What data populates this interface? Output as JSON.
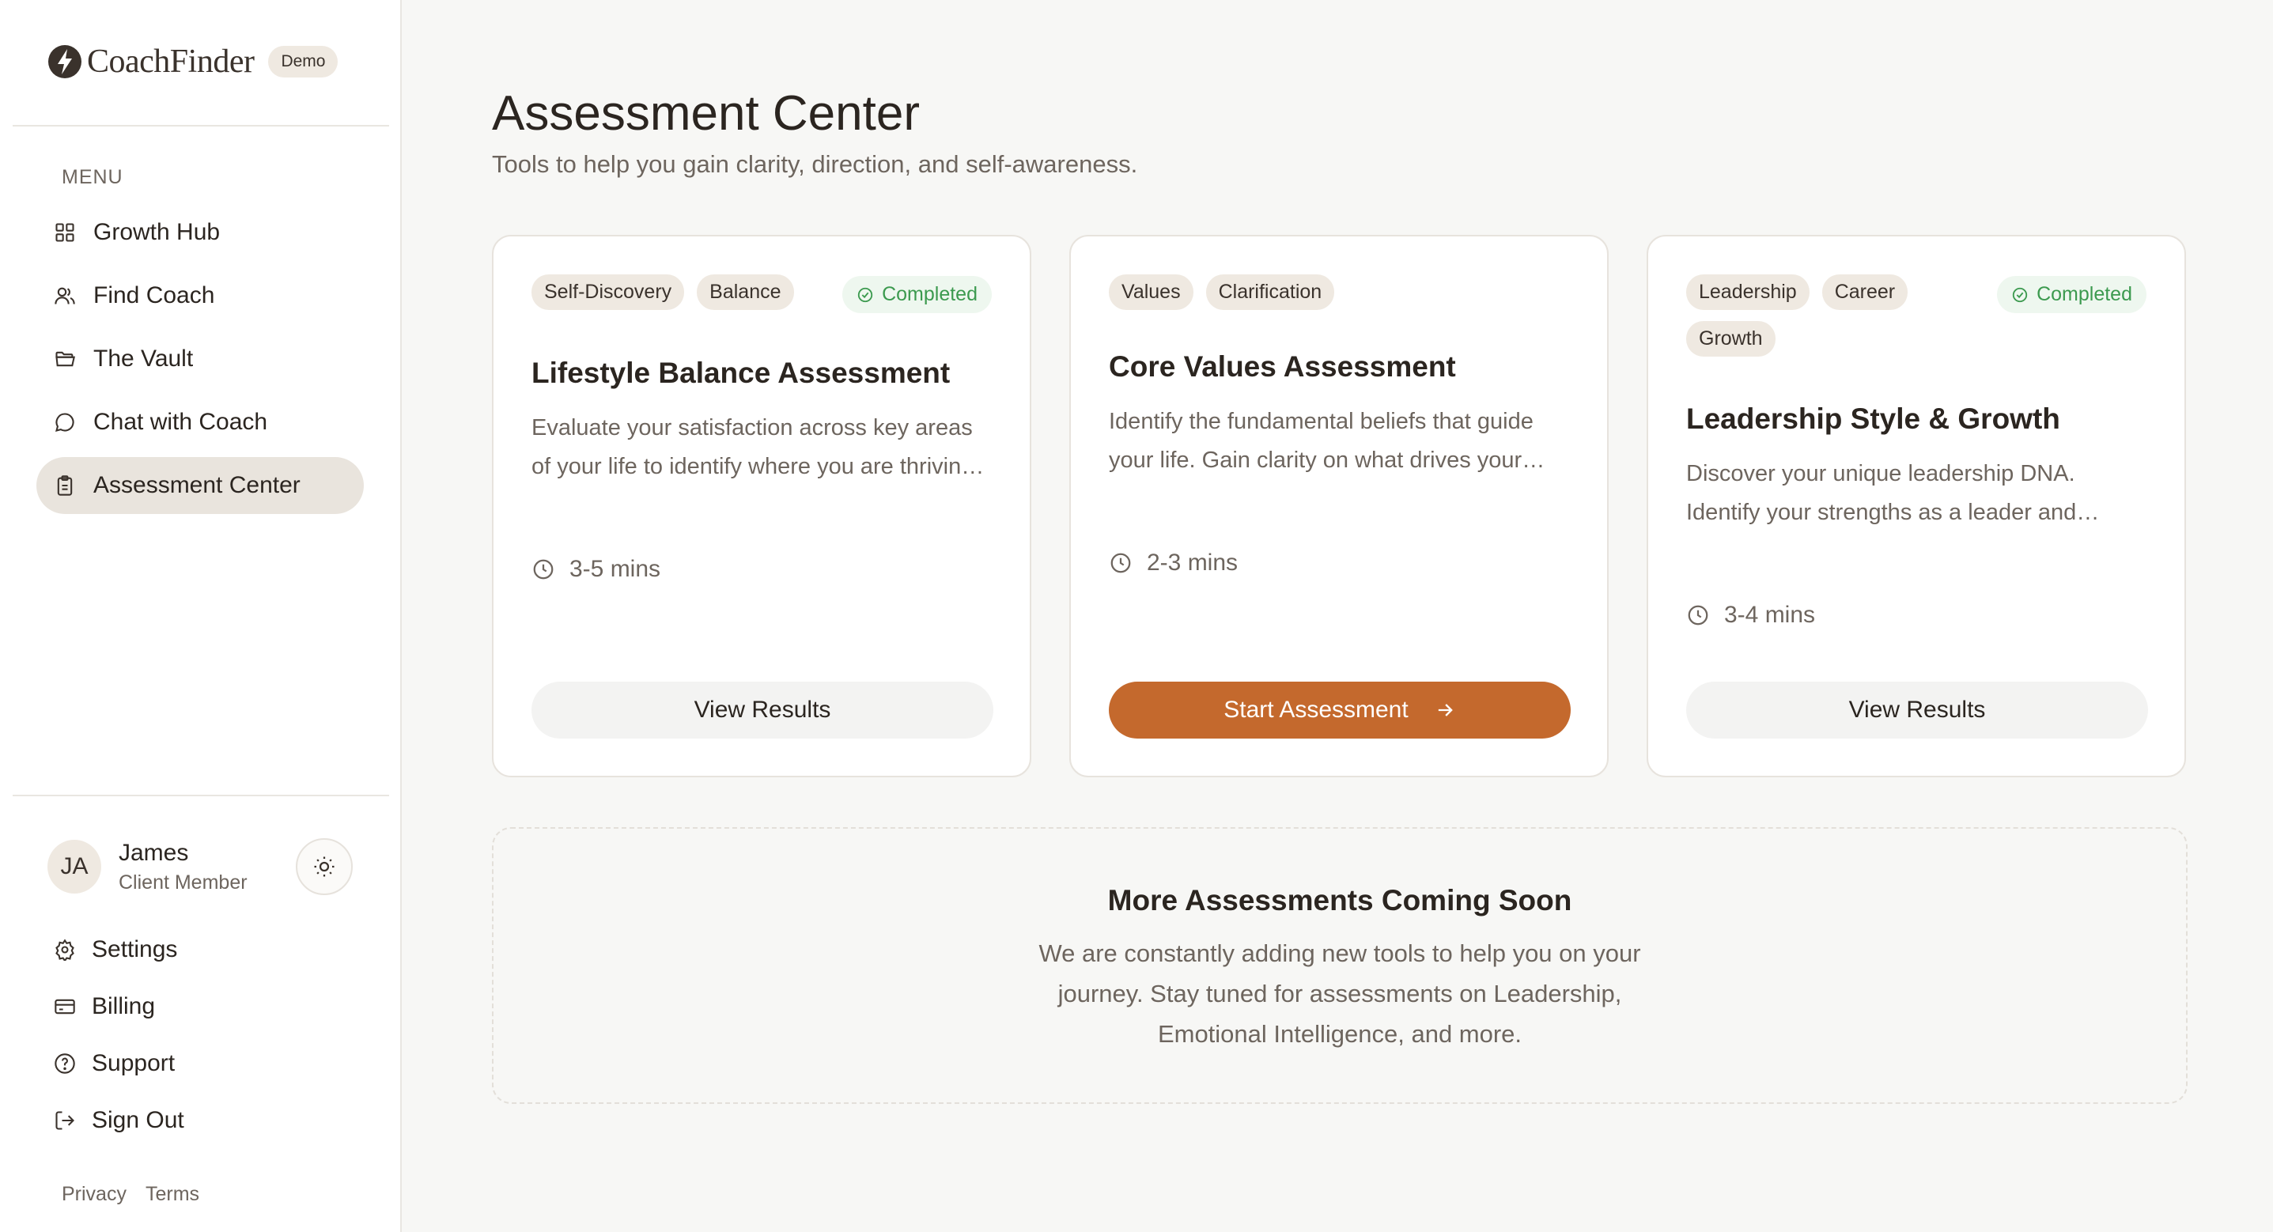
{
  "brand": {
    "name": "CoachFinder",
    "badge": "Demo"
  },
  "sidebar": {
    "menu_label": "MENU",
    "items": [
      {
        "label": "Growth Hub",
        "icon": "grid-icon"
      },
      {
        "label": "Find Coach",
        "icon": "users-icon"
      },
      {
        "label": "The Vault",
        "icon": "folder-icon"
      },
      {
        "label": "Chat with Coach",
        "icon": "chat-icon"
      },
      {
        "label": "Assessment Center",
        "icon": "clipboard-icon",
        "active": true
      }
    ],
    "user": {
      "initials": "JA",
      "name": "James",
      "role": "Client Member"
    },
    "account_items": [
      {
        "label": "Settings",
        "icon": "gear-icon"
      },
      {
        "label": "Billing",
        "icon": "credit-card-icon"
      },
      {
        "label": "Support",
        "icon": "help-circle-icon"
      },
      {
        "label": "Sign Out",
        "icon": "sign-out-icon"
      }
    ],
    "footer": {
      "privacy": "Privacy",
      "terms": "Terms"
    }
  },
  "page": {
    "title": "Assessment Center",
    "subtitle": "Tools to help you gain clarity, direction, and self-awareness."
  },
  "cards": [
    {
      "tags": [
        "Self-Discovery",
        "Balance"
      ],
      "status": "Completed",
      "title": "Lifestyle Balance Assessment",
      "description": "Evaluate your satisfaction across key areas of your life to identify where you are thriving and where you may need more attention.",
      "duration": "3-5 mins",
      "button": "View Results"
    },
    {
      "tags": [
        "Values",
        "Clarification"
      ],
      "status": "",
      "title": "Core Values Assessment",
      "description": "Identify the fundamental beliefs that guide your life. Gain clarity on what drives your decisions and behavior.",
      "duration": "2-3 mins",
      "button": "Start Assessment"
    },
    {
      "tags": [
        "Leadership",
        "Career",
        "Growth"
      ],
      "status": "Completed",
      "title": "Leadership Style & Growth",
      "description": "Discover your unique leadership DNA. Identify your strengths as a leader and growth areas to focus on.",
      "duration": "3-4 mins",
      "button": "View Results"
    }
  ],
  "coming_soon": {
    "title": "More Assessments Coming Soon",
    "description": "We are constantly adding new tools to help you on your journey. Stay tuned for assessments on Leadership, Emotional Intelligence, and more."
  },
  "colors": {
    "accent": "#c4692d",
    "success": "#3c9a4f",
    "tag_bg": "#efe9e1",
    "active_nav": "#e9e4dd"
  }
}
